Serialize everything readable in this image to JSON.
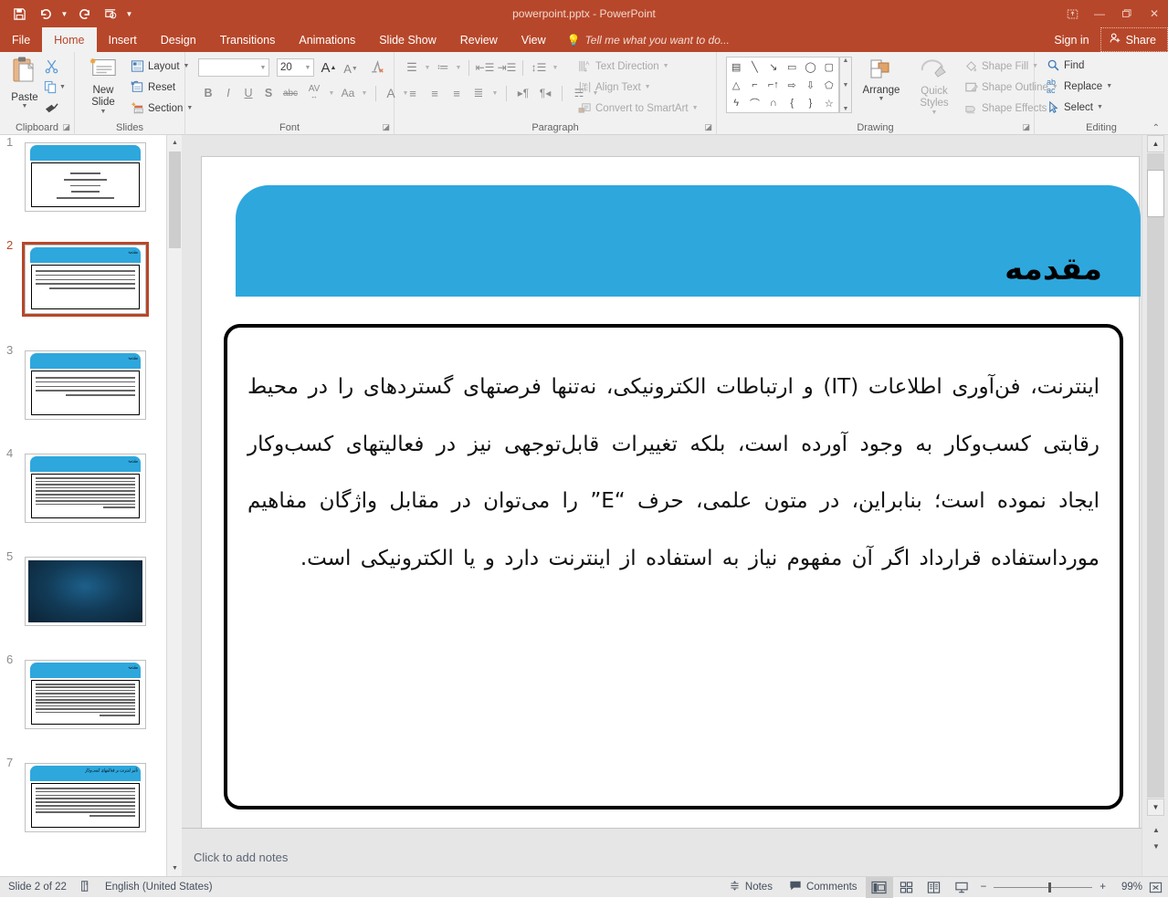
{
  "window": {
    "title": "powerpoint.pptx - PowerPoint",
    "quick_access": [
      "save-icon",
      "undo-icon",
      "redo-icon",
      "start-presentation-icon",
      "customize-qat-icon"
    ],
    "controls": [
      "ribbon-display-options-icon",
      "minimize-icon",
      "restore-icon",
      "close-icon"
    ],
    "sign_in": "Sign in",
    "share": "Share"
  },
  "tabs": [
    {
      "label": "File",
      "active": false
    },
    {
      "label": "Home",
      "active": true
    },
    {
      "label": "Insert",
      "active": false
    },
    {
      "label": "Design",
      "active": false
    },
    {
      "label": "Transitions",
      "active": false
    },
    {
      "label": "Animations",
      "active": false
    },
    {
      "label": "Slide Show",
      "active": false
    },
    {
      "label": "Review",
      "active": false
    },
    {
      "label": "View",
      "active": false
    }
  ],
  "tell_me": "Tell me what you want to do...",
  "ribbon": {
    "clipboard": {
      "label": "Clipboard",
      "paste": "Paste",
      "cut": "Cut",
      "copy": "Copy",
      "format_painter": "Format Painter"
    },
    "slides": {
      "label": "Slides",
      "new_slide": "New Slide",
      "layout": "Layout",
      "reset": "Reset",
      "section": "Section"
    },
    "font": {
      "label": "Font",
      "font_name": "",
      "font_name_placeholder": "",
      "font_size": "20",
      "increase_size": "A",
      "decrease_size": "A",
      "clear_formatting": "Clear All Formatting",
      "bold": "B",
      "italic": "I",
      "underline": "U",
      "shadow": "S",
      "strikethrough": "abc",
      "character_spacing": "AV",
      "change_case": "Aa",
      "font_color": "A"
    },
    "paragraph": {
      "label": "Paragraph",
      "text_direction": "Text Direction",
      "align_text": "Align Text",
      "convert_to_smartart": "Convert to SmartArt"
    },
    "drawing": {
      "label": "Drawing",
      "arrange": "Arrange",
      "quick_styles": "Quick Styles",
      "shape_fill": "Shape Fill",
      "shape_outline": "Shape Outline",
      "shape_effects": "Shape Effects"
    },
    "editing": {
      "label": "Editing",
      "find": "Find",
      "replace": "Replace",
      "select": "Select"
    }
  },
  "thumbnails": [
    {
      "num": "1",
      "kind": "title",
      "selected": false,
      "title": "",
      "lines": 5
    },
    {
      "num": "2",
      "kind": "text",
      "selected": true,
      "title": "مقدمه",
      "lines": 6
    },
    {
      "num": "3",
      "kind": "text",
      "selected": false,
      "title": "مقدمه",
      "lines": 5
    },
    {
      "num": "4",
      "kind": "text",
      "selected": false,
      "title": "مقدمه",
      "lines": 10
    },
    {
      "num": "5",
      "kind": "image",
      "selected": false,
      "title": "",
      "lines": 0
    },
    {
      "num": "6",
      "kind": "text",
      "selected": false,
      "title": "مقدمه",
      "lines": 11
    },
    {
      "num": "7",
      "kind": "text",
      "selected": false,
      "title": "تأثیر اینترنت بر فعالیتهای کسب‌وکار",
      "lines": 10
    }
  ],
  "slide": {
    "title": "مقدمه",
    "body": "اینترنت، فن‌آوری اطلاعات (IT) و ارتباطات الکترونیکی، نه‌تنها فرصتهای گستردهای را در محیط رقابتی کسب‌وکار به وجود آورده است، بلکه تغییرات قابل‌توجهی نیز در فعالیتهای کسب‌وکار ایجاد نموده است؛ بنابراین، در متون علمی، حرف “E” را می‌توان در مقابل واژگان مفاهیم مورداستفاده قرارداد اگر آن مفهوم نیاز به استفاده از اینترنت دارد و یا الکترونیکی است.",
    "band_color": "#2ea7dd"
  },
  "notes": {
    "placeholder": "Click to add notes"
  },
  "status": {
    "slide_counter": "Slide 2 of 22",
    "spell_icon": "spell-check-icon",
    "language": "English (United States)",
    "notes": "Notes",
    "comments": "Comments",
    "views": [
      {
        "name": "normal-view",
        "active": true
      },
      {
        "name": "slide-sorter-view",
        "active": false
      },
      {
        "name": "reading-view",
        "active": false
      },
      {
        "name": "slide-show-view",
        "active": false
      }
    ],
    "zoom_out": "−",
    "zoom_in": "+",
    "zoom_level": "99%",
    "fit_slide": "fit-to-window-icon"
  }
}
